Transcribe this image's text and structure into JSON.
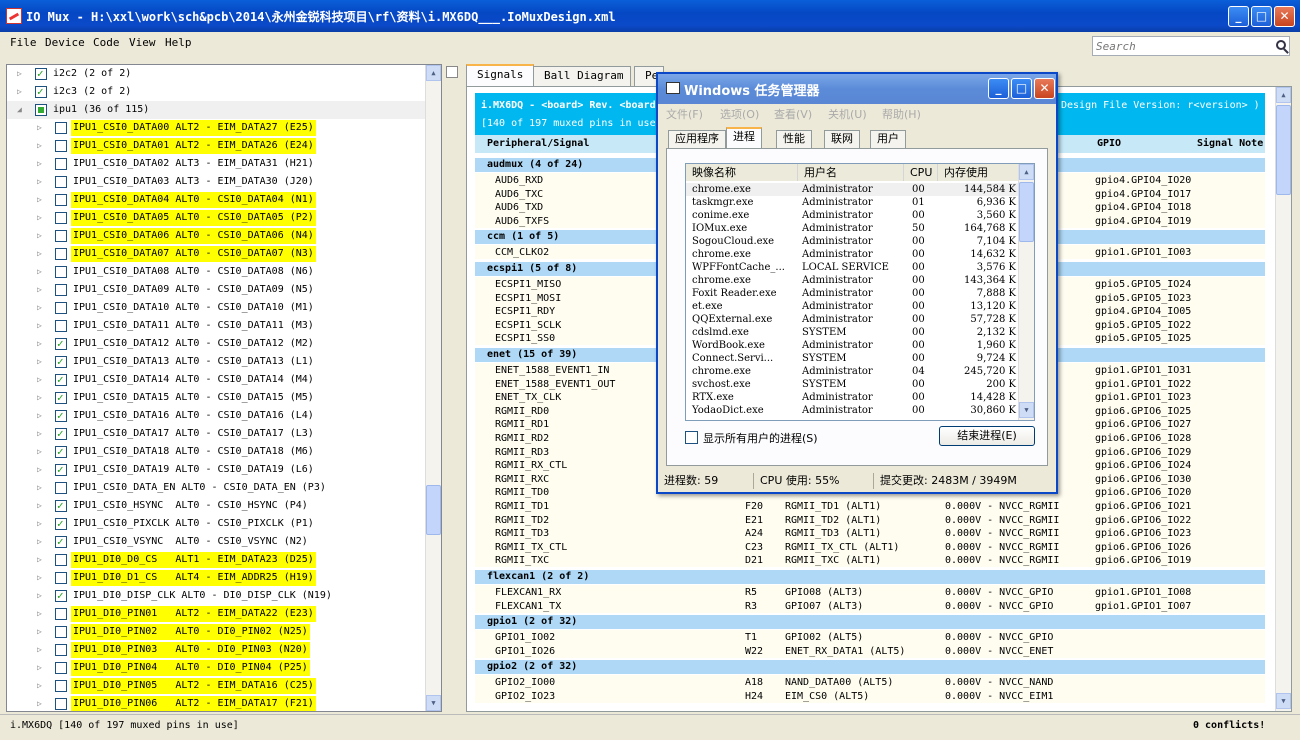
{
  "title": "IO Mux - H:\\xxl\\work\\sch&pcb\\2014\\永州金锐科技项目\\rf\\资料\\i.MX6DQ___.IoMuxDesign.xml",
  "menu": [
    "File",
    "Device",
    "Code",
    "View",
    "Help"
  ],
  "search": {
    "placeholder": "Search"
  },
  "tree": [
    {
      "label": "i2c2 (2 of 2)",
      "state": "on",
      "level": 1,
      "hl": false
    },
    {
      "label": "i2c3 (2 of 2)",
      "state": "on",
      "level": 1,
      "hl": false
    },
    {
      "label": "ipu1 (36 of 115)",
      "state": "part",
      "level": 1,
      "hl": false,
      "open": true
    },
    {
      "label": "IPU1_CSI0_DATA00 ALT2 - EIM_DATA27 (E25)",
      "state": "off",
      "level": 2,
      "hl": true
    },
    {
      "label": "IPU1_CSI0_DATA01 ALT2 - EIM_DATA26 (E24)",
      "state": "off",
      "level": 2,
      "hl": true
    },
    {
      "label": "IPU1_CSI0_DATA02 ALT3 - EIM_DATA31 (H21)",
      "state": "off",
      "level": 2,
      "hl": false
    },
    {
      "label": "IPU1_CSI0_DATA03 ALT3 - EIM_DATA30 (J20)",
      "state": "off",
      "level": 2,
      "hl": false
    },
    {
      "label": "IPU1_CSI0_DATA04 ALT0 - CSI0_DATA04 (N1)",
      "state": "off",
      "level": 2,
      "hl": true
    },
    {
      "label": "IPU1_CSI0_DATA05 ALT0 - CSI0_DATA05 (P2)",
      "state": "off",
      "level": 2,
      "hl": true
    },
    {
      "label": "IPU1_CSI0_DATA06 ALT0 - CSI0_DATA06 (N4)",
      "state": "off",
      "level": 2,
      "hl": true
    },
    {
      "label": "IPU1_CSI0_DATA07 ALT0 - CSI0_DATA07 (N3)",
      "state": "off",
      "level": 2,
      "hl": true
    },
    {
      "label": "IPU1_CSI0_DATA08 ALT0 - CSI0_DATA08 (N6)",
      "state": "off",
      "level": 2,
      "hl": false
    },
    {
      "label": "IPU1_CSI0_DATA09 ALT0 - CSI0_DATA09 (N5)",
      "state": "off",
      "level": 2,
      "hl": false
    },
    {
      "label": "IPU1_CSI0_DATA10 ALT0 - CSI0_DATA10 (M1)",
      "state": "off",
      "level": 2,
      "hl": false
    },
    {
      "label": "IPU1_CSI0_DATA11 ALT0 - CSI0_DATA11 (M3)",
      "state": "off",
      "level": 2,
      "hl": false
    },
    {
      "label": "IPU1_CSI0_DATA12 ALT0 - CSI0_DATA12 (M2)",
      "state": "on",
      "level": 2,
      "hl": false
    },
    {
      "label": "IPU1_CSI0_DATA13 ALT0 - CSI0_DATA13 (L1)",
      "state": "on",
      "level": 2,
      "hl": false
    },
    {
      "label": "IPU1_CSI0_DATA14 ALT0 - CSI0_DATA14 (M4)",
      "state": "on",
      "level": 2,
      "hl": false
    },
    {
      "label": "IPU1_CSI0_DATA15 ALT0 - CSI0_DATA15 (M5)",
      "state": "on",
      "level": 2,
      "hl": false
    },
    {
      "label": "IPU1_CSI0_DATA16 ALT0 - CSI0_DATA16 (L4)",
      "state": "on",
      "level": 2,
      "hl": false
    },
    {
      "label": "IPU1_CSI0_DATA17 ALT0 - CSI0_DATA17 (L3)",
      "state": "on",
      "level": 2,
      "hl": false
    },
    {
      "label": "IPU1_CSI0_DATA18 ALT0 - CSI0_DATA18 (M6)",
      "state": "on",
      "level": 2,
      "hl": false
    },
    {
      "label": "IPU1_CSI0_DATA19 ALT0 - CSI0_DATA19 (L6)",
      "state": "on",
      "level": 2,
      "hl": false
    },
    {
      "label": "IPU1_CSI0_DATA_EN ALT0 - CSI0_DATA_EN (P3)",
      "state": "off",
      "level": 2,
      "hl": false
    },
    {
      "label": "IPU1_CSI0_HSYNC  ALT0 - CSI0_HSYNC (P4)",
      "state": "on",
      "level": 2,
      "hl": false
    },
    {
      "label": "IPU1_CSI0_PIXCLK ALT0 - CSI0_PIXCLK (P1)",
      "state": "on",
      "level": 2,
      "hl": false
    },
    {
      "label": "IPU1_CSI0_VSYNC  ALT0 - CSI0_VSYNC (N2)",
      "state": "on",
      "level": 2,
      "hl": false
    },
    {
      "label": "IPU1_DI0_D0_CS   ALT1 - EIM_DATA23 (D25)",
      "state": "off",
      "level": 2,
      "hl": true
    },
    {
      "label": "IPU1_DI0_D1_CS   ALT4 - EIM_ADDR25 (H19)",
      "state": "off",
      "level": 2,
      "hl": true
    },
    {
      "label": "IPU1_DI0_DISP_CLK ALT0 - DI0_DISP_CLK (N19)",
      "state": "on",
      "level": 2,
      "hl": false
    },
    {
      "label": "IPU1_DI0_PIN01   ALT2 - EIM_DATA22 (E23)",
      "state": "off",
      "level": 2,
      "hl": true
    },
    {
      "label": "IPU1_DI0_PIN02   ALT0 - DI0_PIN02 (N25)",
      "state": "off",
      "level": 2,
      "hl": true
    },
    {
      "label": "IPU1_DI0_PIN03   ALT0 - DI0_PIN03 (N20)",
      "state": "off",
      "level": 2,
      "hl": true
    },
    {
      "label": "IPU1_DI0_PIN04   ALT0 - DI0_PIN04 (P25)",
      "state": "off",
      "level": 2,
      "hl": true
    },
    {
      "label": "IPU1_DI0_PIN05   ALT2 - EIM_DATA16 (C25)",
      "state": "off",
      "level": 2,
      "hl": true
    },
    {
      "label": "IPU1_DI0_PIN06   ALT2 - EIM_DATA17 (F21)",
      "state": "off",
      "level": 2,
      "hl": true
    }
  ],
  "tabs": [
    "Signals",
    "Ball Diagram",
    "Pe"
  ],
  "main": {
    "header": "i.MX6DQ - <board> Rev. <board",
    "header_right": "Design File Version: r<version> )",
    "pins_in_use": "[140 of 197 muxed pins in use]",
    "col_signal": "Peripheral/Signal",
    "col_gpio": "GPIO",
    "col_note": "Signal Note",
    "groups": [
      {
        "name": "audmux (4 of 24)",
        "rows": [
          [
            "AUD6_RXD",
            "",
            "",
            "",
            "gpio4.GPIO4_IO20"
          ],
          [
            "AUD6_TXC",
            "",
            "",
            "",
            "gpio4.GPIO4_IO17"
          ],
          [
            "AUD6_TXD",
            "",
            "",
            "",
            "gpio4.GPIO4_IO18"
          ],
          [
            "AUD6_TXFS",
            "",
            "",
            "",
            "gpio4.GPIO4_IO19"
          ]
        ]
      },
      {
        "name": "ccm (1 of 5)",
        "rows": [
          [
            "CCM_CLKO2",
            "",
            "",
            "",
            "gpio1.GPIO1_IO03"
          ]
        ]
      },
      {
        "name": "ecspi1 (5 of 8)",
        "rows": [
          [
            "ECSPI1_MISO",
            "",
            "",
            "",
            "gpio5.GPIO5_IO24"
          ],
          [
            "ECSPI1_MOSI",
            "",
            "",
            "",
            "gpio5.GPIO5_IO23"
          ],
          [
            "ECSPI1_RDY",
            "",
            "",
            "",
            "gpio4.GPIO4_IO05"
          ],
          [
            "ECSPI1_SCLK",
            "",
            "",
            "",
            "gpio5.GPIO5_IO22"
          ],
          [
            "ECSPI1_SS0",
            "",
            "",
            "",
            "gpio5.GPIO5_IO25"
          ]
        ]
      },
      {
        "name": "enet (15 of 39)",
        "rows": [
          [
            "ENET_1588_EVENT1_IN",
            "",
            "",
            "",
            "gpio1.GPIO1_IO31"
          ],
          [
            "ENET_1588_EVENT1_OUT",
            "",
            "",
            "",
            "gpio1.GPIO1_IO22"
          ],
          [
            "ENET_TX_CLK",
            "",
            "",
            "",
            "gpio1.GPIO1_IO23"
          ],
          [
            "RGMII_RD0",
            "",
            "",
            "",
            "gpio6.GPIO6_IO25"
          ],
          [
            "RGMII_RD1",
            "",
            "",
            "",
            "gpio6.GPIO6_IO27"
          ],
          [
            "RGMII_RD2",
            "",
            "",
            "",
            "gpio6.GPIO6_IO28"
          ],
          [
            "RGMII_RD3",
            "",
            "",
            "",
            "gpio6.GPIO6_IO29"
          ],
          [
            "RGMII_RX_CTL",
            "",
            "",
            "",
            "gpio6.GPIO6_IO24"
          ],
          [
            "RGMII_RXC",
            "",
            "",
            "",
            "gpio6.GPIO6_IO30"
          ],
          [
            "RGMII_TD0",
            "",
            "",
            "",
            "gpio6.GPIO6_IO20"
          ],
          [
            "RGMII_TD1",
            "F20",
            "RGMII_TD1 (ALT1)",
            "0.000V - NVCC_RGMII",
            "gpio6.GPIO6_IO21"
          ],
          [
            "RGMII_TD2",
            "E21",
            "RGMII_TD2 (ALT1)",
            "0.000V - NVCC_RGMII",
            "gpio6.GPIO6_IO22"
          ],
          [
            "RGMII_TD3",
            "A24",
            "RGMII_TD3 (ALT1)",
            "0.000V - NVCC_RGMII",
            "gpio6.GPIO6_IO23"
          ],
          [
            "RGMII_TX_CTL",
            "C23",
            "RGMII_TX_CTL (ALT1)",
            "0.000V - NVCC_RGMII",
            "gpio6.GPIO6_IO26"
          ],
          [
            "RGMII_TXC",
            "D21",
            "RGMII_TXC (ALT1)",
            "0.000V - NVCC_RGMII",
            "gpio6.GPIO6_IO19"
          ]
        ]
      },
      {
        "name": "flexcan1 (2 of 2)",
        "rows": [
          [
            "FLEXCAN1_RX",
            "R5",
            "GPIO08 (ALT3)",
            "0.000V - NVCC_GPIO",
            "gpio1.GPIO1_IO08"
          ],
          [
            "FLEXCAN1_TX",
            "R3",
            "GPIO07 (ALT3)",
            "0.000V - NVCC_GPIO",
            "gpio1.GPIO1_IO07"
          ]
        ]
      },
      {
        "name": "gpio1 (2 of 32)",
        "rows": [
          [
            "GPIO1_IO02",
            "T1",
            "GPIO02 (ALT5)",
            "0.000V - NVCC_GPIO",
            ""
          ],
          [
            "GPIO1_IO26",
            "W22",
            "ENET_RX_DATA1 (ALT5)",
            "0.000V - NVCC_ENET",
            ""
          ]
        ]
      },
      {
        "name": "gpio2 (2 of 32)",
        "rows": [
          [
            "GPIO2_IO00",
            "A18",
            "NAND_DATA00 (ALT5)",
            "0.000V - NVCC_NAND",
            ""
          ],
          [
            "GPIO2_IO23",
            "H24",
            "EIM_CS0 (ALT5)",
            "0.000V - NVCC_EIM1",
            ""
          ]
        ]
      }
    ]
  },
  "taskmgr": {
    "title": "Windows 任务管理器",
    "menu": [
      "文件(F)",
      "选项(O)",
      "查看(V)",
      "关机(U)",
      "帮助(H)"
    ],
    "tabs": [
      "应用程序",
      "进程",
      "性能",
      "联网",
      "用户"
    ],
    "columns": [
      "映像名称",
      "用户名",
      "CPU",
      "内存使用"
    ],
    "processes": [
      [
        "chrome.exe",
        "Administrator",
        "00",
        "144,584 K"
      ],
      [
        "taskmgr.exe",
        "Administrator",
        "01",
        "6,936 K"
      ],
      [
        "conime.exe",
        "Administrator",
        "00",
        "3,560 K"
      ],
      [
        "IOMux.exe",
        "Administrator",
        "50",
        "164,768 K"
      ],
      [
        "SogouCloud.exe",
        "Administrator",
        "00",
        "7,104 K"
      ],
      [
        "chrome.exe",
        "Administrator",
        "00",
        "14,632 K"
      ],
      [
        "WPFFontCache_...",
        "LOCAL SERVICE",
        "00",
        "3,576 K"
      ],
      [
        "chrome.exe",
        "Administrator",
        "00",
        "143,364 K"
      ],
      [
        "Foxit Reader.exe",
        "Administrator",
        "00",
        "7,888 K"
      ],
      [
        "et.exe",
        "Administrator",
        "00",
        "13,120 K"
      ],
      [
        "QQExternal.exe",
        "Administrator",
        "00",
        "57,728 K"
      ],
      [
        "cdslmd.exe",
        "SYSTEM",
        "00",
        "2,132 K"
      ],
      [
        "WordBook.exe",
        "Administrator",
        "00",
        "1,960 K"
      ],
      [
        "Connect.Servi...",
        "SYSTEM",
        "00",
        "9,724 K"
      ],
      [
        "chrome.exe",
        "Administrator",
        "04",
        "245,720 K"
      ],
      [
        "svchost.exe",
        "SYSTEM",
        "00",
        "200 K"
      ],
      [
        "RTX.exe",
        "Administrator",
        "00",
        "14,428 K"
      ],
      [
        "YodaoDict.exe",
        "Administrator",
        "00",
        "30,860 K"
      ]
    ],
    "show_all": "显示所有用户的进程(S)",
    "end_process": "结束进程(E)",
    "status": [
      "进程数: 59",
      "CPU 使用: 55%",
      "提交更改: 2483M / 3949M"
    ]
  },
  "status": {
    "left": "i.MX6DQ  [140 of 197 muxed pins in use]",
    "right": "0 conflicts!"
  }
}
